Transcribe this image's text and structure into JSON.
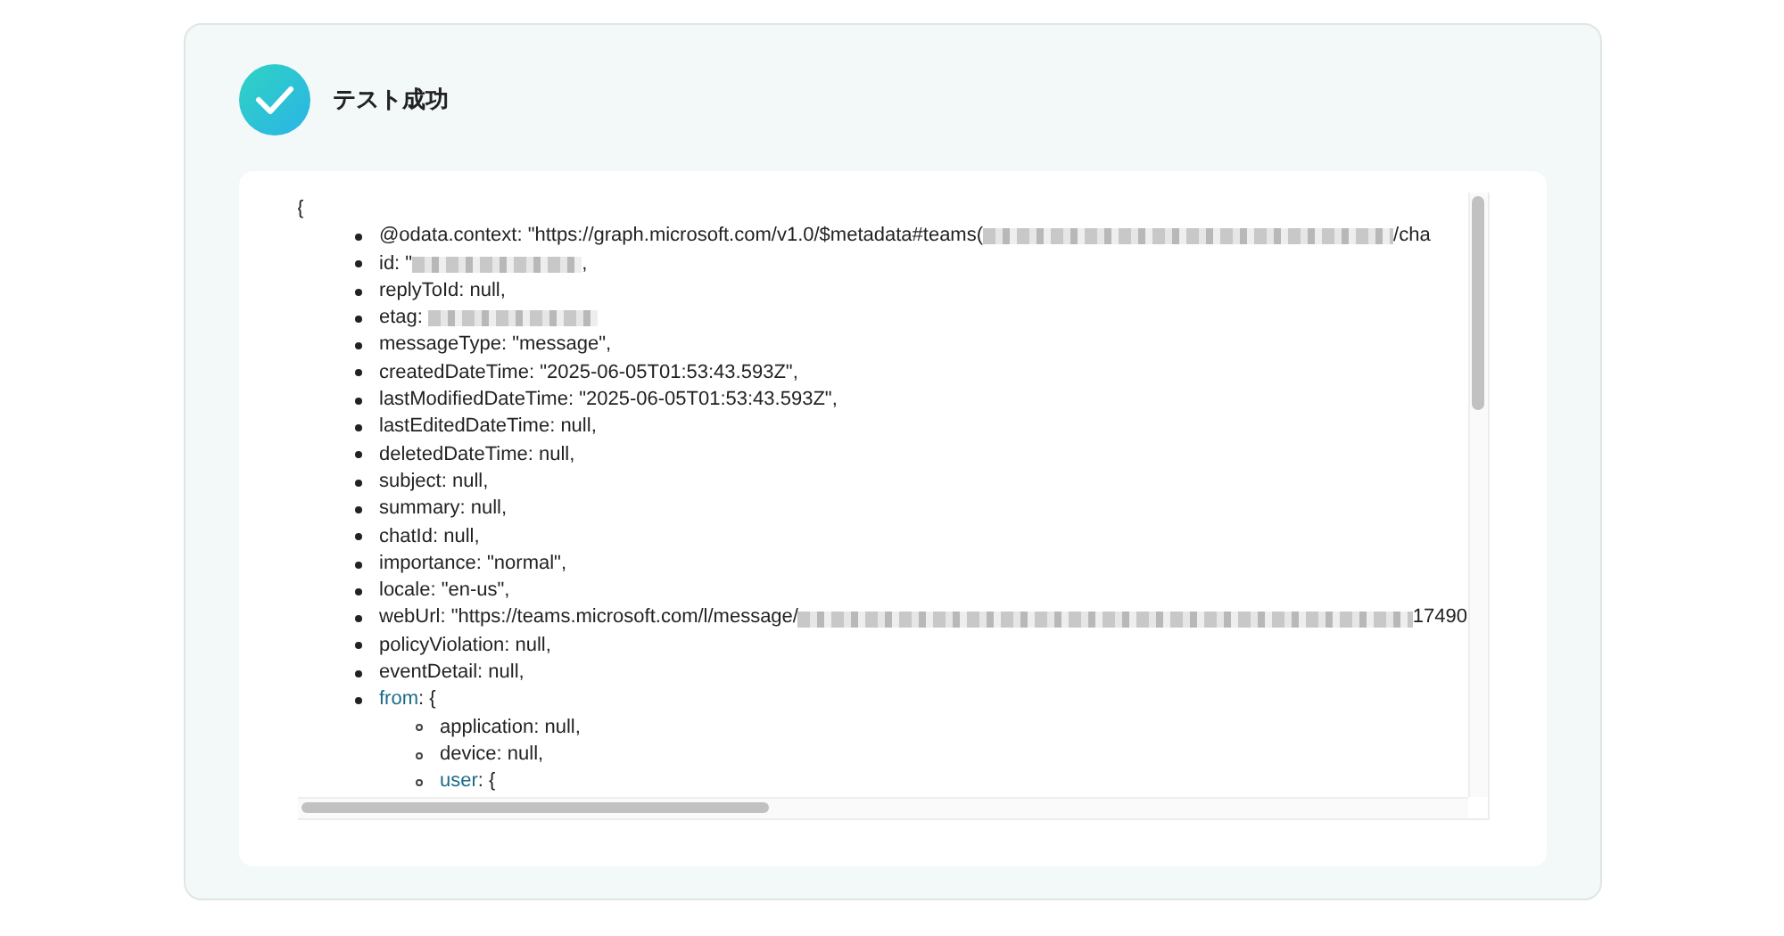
{
  "result": {
    "title": "テスト成功"
  },
  "viewer": {
    "open_brace": "{",
    "items": [
      {
        "kind": "redacted",
        "text": "@odata.context: \"https://graph.microsoft.com/v1.0/$metadata#teams(",
        "after": "/cha"
      },
      {
        "kind": "redacted",
        "text": "id: \"",
        "after": ","
      },
      {
        "kind": "field",
        "text": "replyToId: null,"
      },
      {
        "kind": "redacted",
        "text": "etag: "
      },
      {
        "kind": "field",
        "text": "messageType: \"message\","
      },
      {
        "kind": "field",
        "text": "createdDateTime: \"2025-06-05T01:53:43.593Z\","
      },
      {
        "kind": "field",
        "text": "lastModifiedDateTime: \"2025-06-05T01:53:43.593Z\","
      },
      {
        "kind": "field",
        "text": "lastEditedDateTime: null,"
      },
      {
        "kind": "field",
        "text": "deletedDateTime: null,"
      },
      {
        "kind": "field",
        "text": "subject: null,"
      },
      {
        "kind": "field",
        "text": "summary: null,"
      },
      {
        "kind": "field",
        "text": "chatId: null,"
      },
      {
        "kind": "field",
        "text": "importance: \"normal\","
      },
      {
        "kind": "field",
        "text": "locale: \"en-us\","
      },
      {
        "kind": "redacted",
        "text": "webUrl: \"https://teams.microsoft.com/l/message/",
        "after": "17490"
      },
      {
        "kind": "field",
        "text": "policyViolation: null,"
      },
      {
        "kind": "field",
        "text": "eventDetail: null,"
      },
      {
        "kind": "object",
        "key": "from",
        "text": ": {",
        "children": [
          {
            "kind": "field",
            "text": "application: null,"
          },
          {
            "kind": "field",
            "text": "device: null,"
          },
          {
            "kind": "object",
            "key": "user",
            "text": ": {"
          }
        ]
      }
    ]
  }
}
